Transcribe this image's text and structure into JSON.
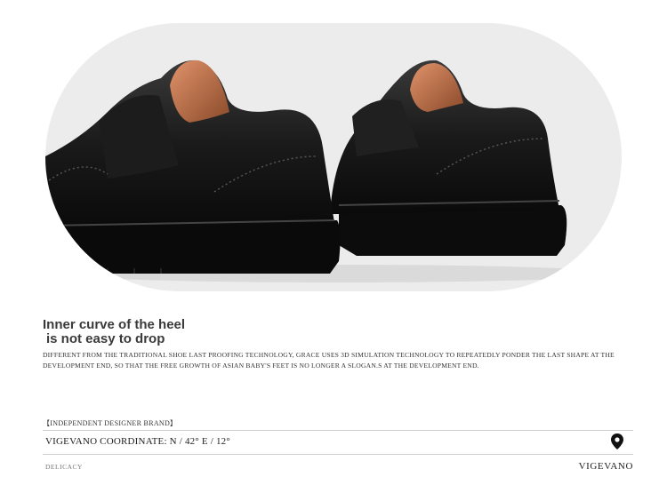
{
  "headline": {
    "line1": "Inner curve of the heel",
    "line2": "is not easy to drop"
  },
  "description": "Different from the traditional shoe last proofing technology, Grace uses 3D simulation technology to repeatedly ponder the last shape at the development end, so that the free growth of Asian baby's feet is no longer a slogan.s at the development end.",
  "footer": {
    "brand_tag": "【INDEPENDENT DESIGNER BRAND】",
    "coordinate": "VIGEVANO COORDINATE: N / 42°  E / 12°",
    "left_caption": "DELICACY",
    "right_caption": "VIGEVANO"
  },
  "icons": {
    "location": "map-pin-icon"
  },
  "colors": {
    "hero_bg": "#ececec",
    "shoe": "#141414",
    "lining": "#c97a4e"
  }
}
